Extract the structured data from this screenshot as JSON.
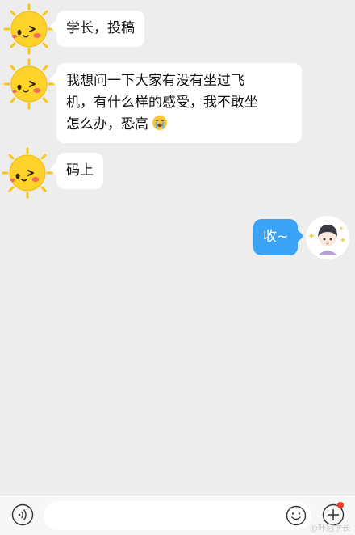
{
  "messages": [
    {
      "side": "left",
      "text": "学长，投稿"
    },
    {
      "side": "left",
      "lines": [
        "我想问一下大家有没有坐过飞",
        "机，有什么样的感受，我不敢坐",
        "怎么办，恐高"
      ]
    },
    {
      "side": "left",
      "text": "码上"
    },
    {
      "side": "right",
      "text": "收~"
    }
  ],
  "input": {
    "placeholder": ""
  },
  "watermark": "@叶冠学长",
  "colors": {
    "background": "#ededed",
    "bubble_left": "#ffffff",
    "bubble_right": "#3aa3f6",
    "badge": "#f5372c"
  },
  "icons": {
    "contact_avatar": "sun-face-icon",
    "self_avatar": "cartoon-boy-icon",
    "emoji": "crying-emoji-icon",
    "voice": "voice-icon",
    "emoji_button": "smiley-icon",
    "more": "plus-circle-icon"
  }
}
